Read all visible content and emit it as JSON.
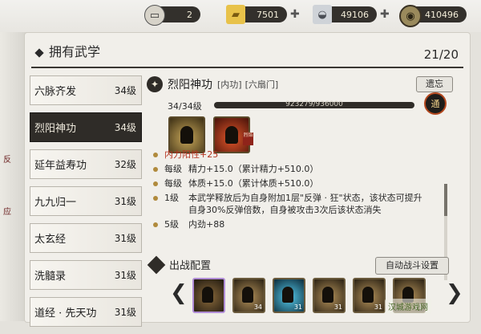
{
  "resources": [
    {
      "name": "mail",
      "icon": "mailbox-icon",
      "value": "2"
    },
    {
      "name": "gold-ingot",
      "icon": "gold-ingot-icon",
      "value": "7501"
    },
    {
      "name": "silver-ingot",
      "icon": "silver-ingot-icon",
      "value": "49106"
    },
    {
      "name": "copper-coin",
      "icon": "coin-icon",
      "value": "410496"
    }
  ],
  "panel": {
    "title": "拥有武学",
    "count": "21/20"
  },
  "skills": [
    {
      "name": "六脉齐发",
      "level": "34级",
      "selected": false
    },
    {
      "name": "烈阳神功",
      "level": "34级",
      "selected": true
    },
    {
      "name": "延年益寿功",
      "level": "32级",
      "selected": false
    },
    {
      "name": "九九归一",
      "level": "31级",
      "selected": false
    },
    {
      "name": "太玄经",
      "level": "31级",
      "selected": false
    },
    {
      "name": "洗髓录",
      "level": "31级",
      "selected": false
    },
    {
      "name": "道经 · 先天功",
      "level": "31级",
      "selected": false
    }
  ],
  "detail": {
    "name": "烈阳神功",
    "tag1": "[内功]",
    "tag2": "[六扇门]",
    "forget_label": "遗忘",
    "level_text": "34/34级",
    "exp_text": "923279/936000",
    "exp_ratio": 0.986,
    "enhance_label": "通",
    "card_tag": "烈焰",
    "attributes": [
      {
        "k": "",
        "v": "内力阳性+25",
        "highlight": true
      },
      {
        "k": "每级",
        "v": "精力+15.0（累计精力+510.0）"
      },
      {
        "k": "每级",
        "v": "体质+15.0（累计体质+510.0）"
      },
      {
        "k": "1级",
        "v": "本武学释放后为自身附加1层\"反弹 · 狂\"状态，该状态可提升自身30%反弹倍数，自身被攻击3次后该状态消失"
      },
      {
        "k": "5级",
        "v": "内劲+88"
      }
    ]
  },
  "battle": {
    "title": "出战配置",
    "auto_label": "自动战斗设置",
    "slots": [
      {
        "num": "",
        "style": "first"
      },
      {
        "num": "34",
        "style": "gold"
      },
      {
        "num": "31",
        "style": "cyan"
      },
      {
        "num": "31",
        "style": "gold"
      },
      {
        "num": "31",
        "style": "gold"
      },
      {
        "num": "31",
        "style": "gold"
      }
    ]
  },
  "side_glyphs": [
    "反",
    "应"
  ],
  "watermark": "汉城游戏网"
}
